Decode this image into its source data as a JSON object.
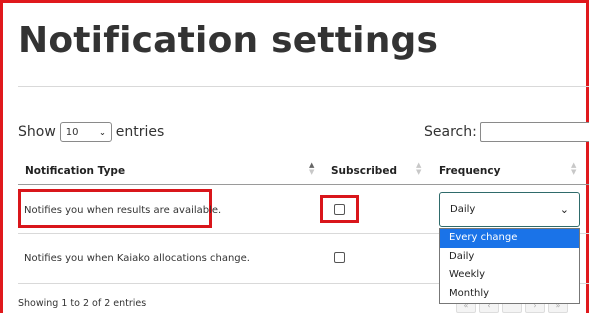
{
  "page": {
    "title": "Notification settings"
  },
  "table_controls": {
    "show_label": "Show",
    "entries_per_page": "10",
    "entries_label": "entries",
    "search_label": "Search:",
    "search_value": ""
  },
  "table": {
    "headers": [
      "Notification Type",
      "Subscribed",
      "Frequency"
    ],
    "rows": [
      {
        "type": "Notifies you when results are available.",
        "subscribed": false,
        "frequency": "Daily"
      },
      {
        "type": "Notifies you when Kaiako allocations change.",
        "subscribed": false,
        "frequency": ""
      }
    ]
  },
  "frequency_dropdown": {
    "selected": "Daily",
    "highlighted": "Every change",
    "options": [
      "Every change",
      "Daily",
      "Weekly",
      "Monthly"
    ]
  },
  "footer": {
    "info": "Showing 1 to 2 of 2 entries"
  },
  "colors": {
    "highlight_border": "#d9161b",
    "option_highlight": "#1a73e8"
  }
}
